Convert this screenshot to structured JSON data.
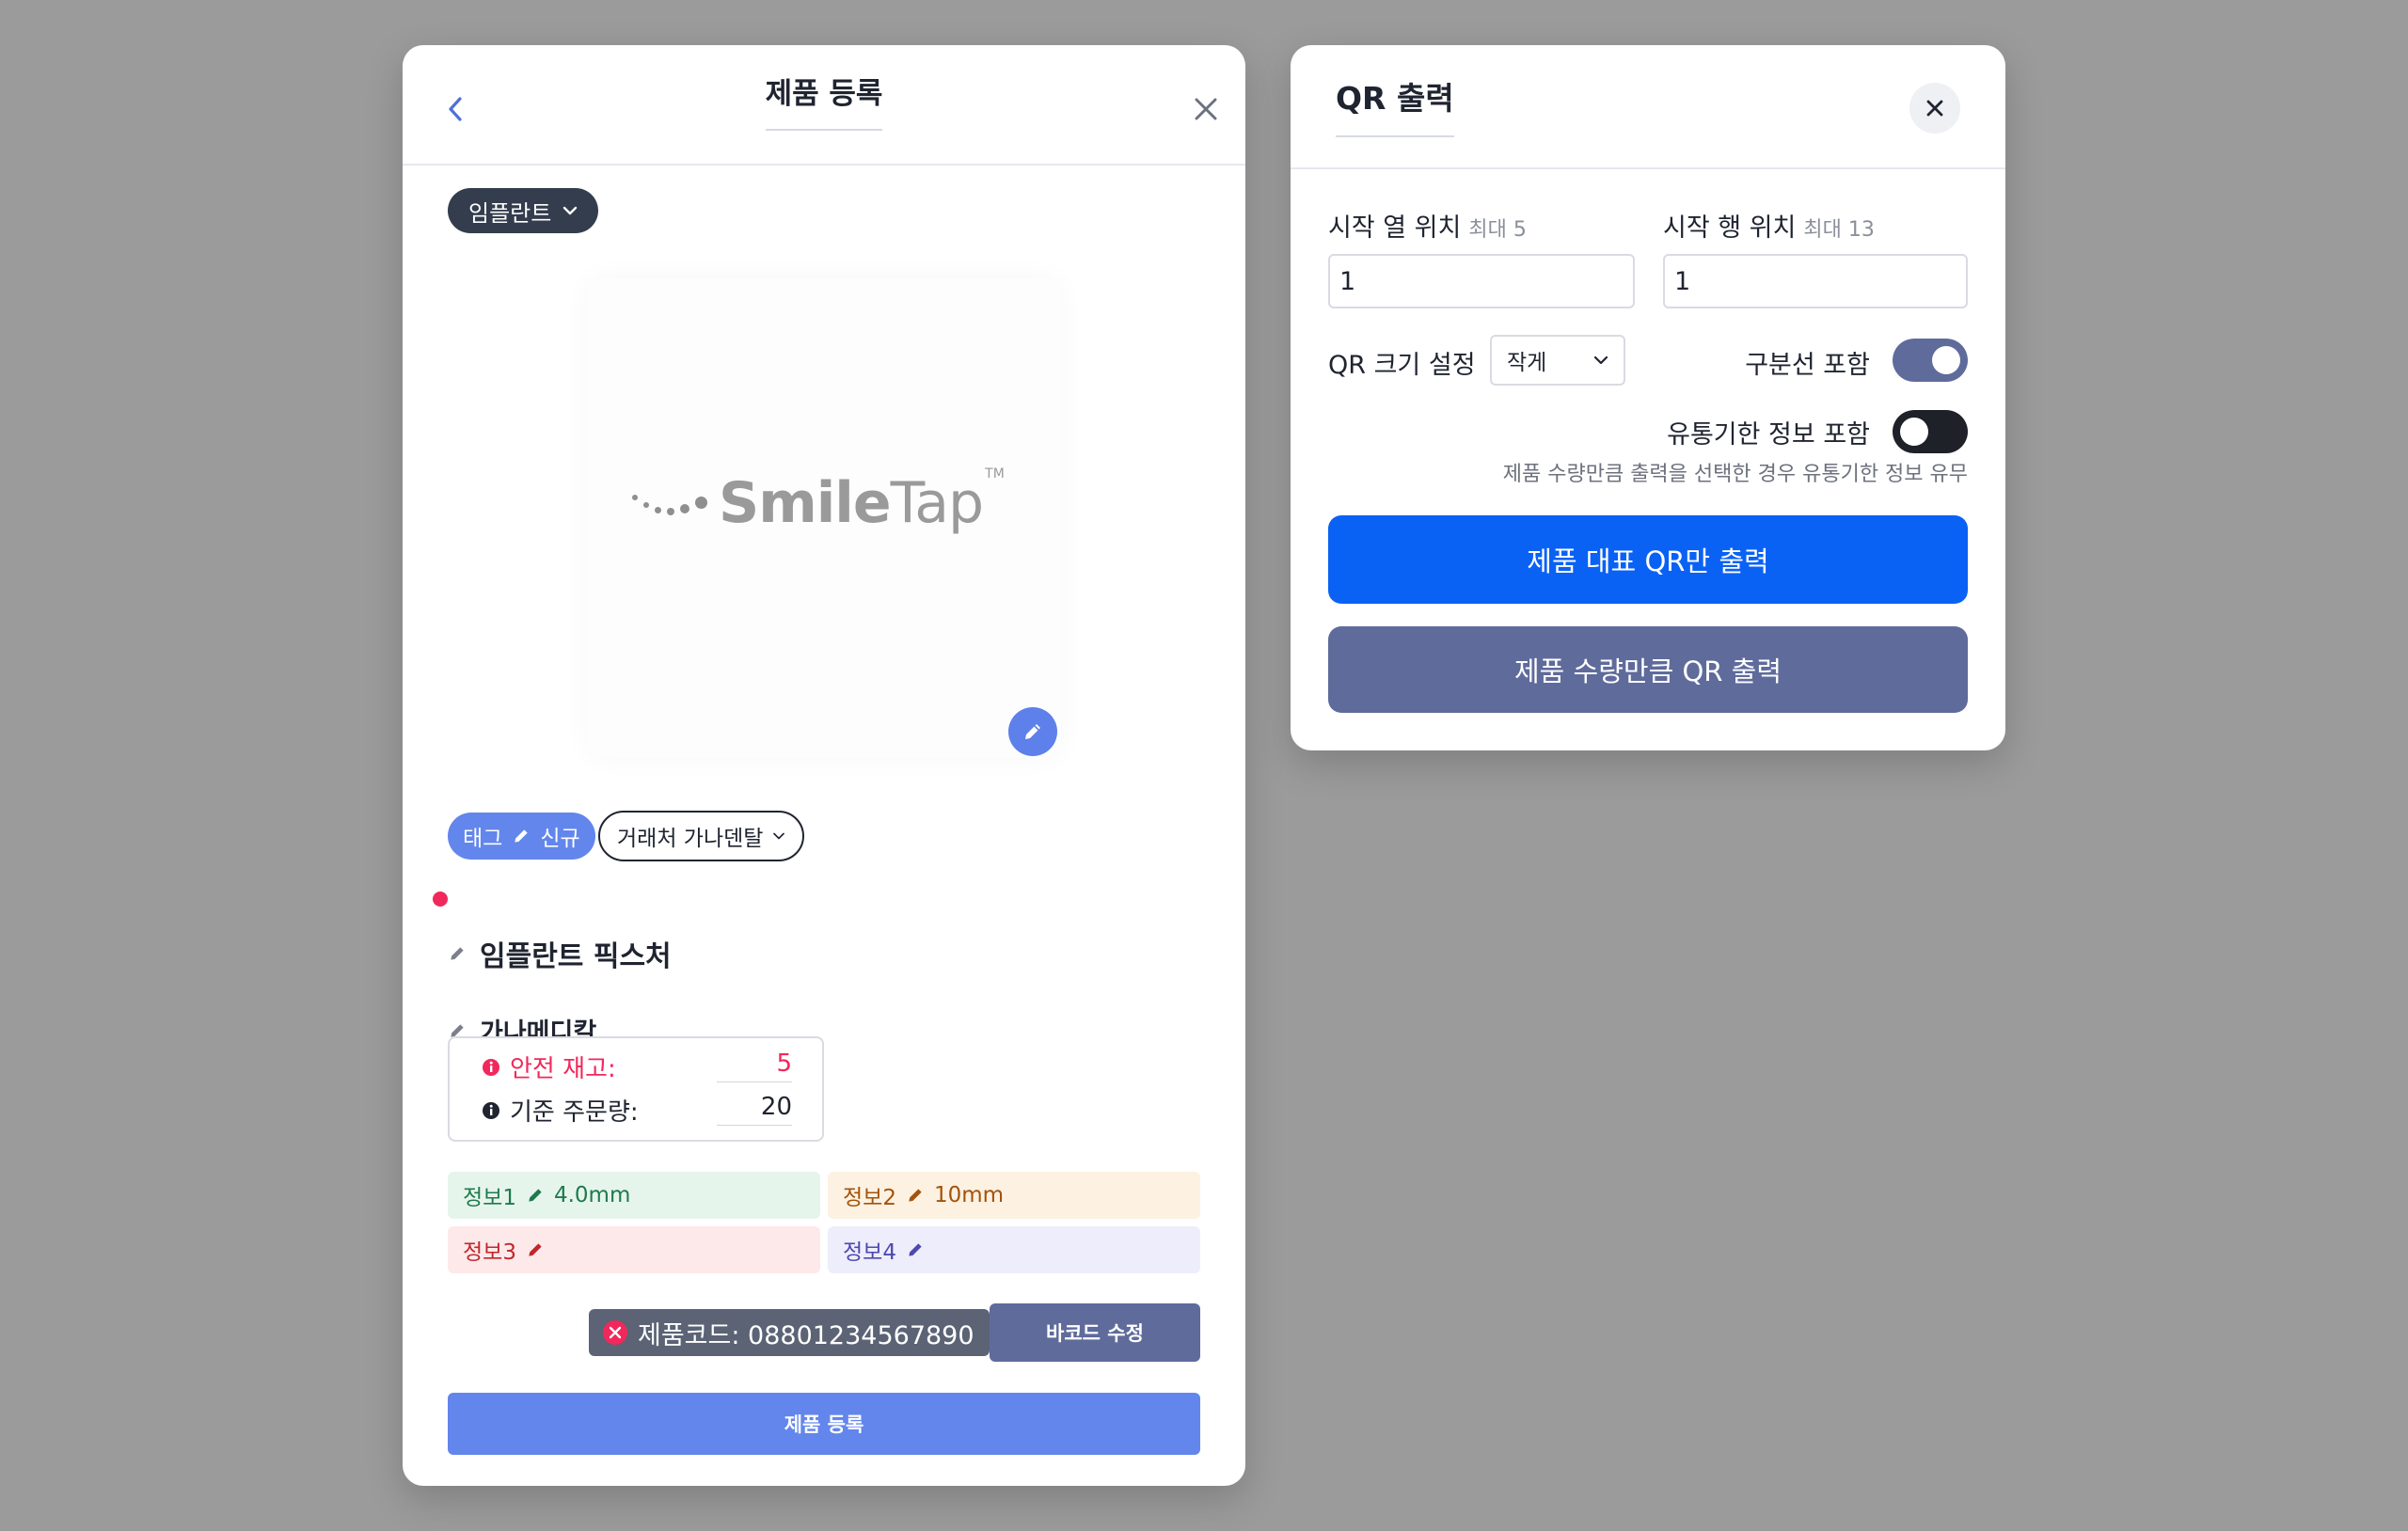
{
  "product_modal": {
    "title": "제품 등록",
    "category": "임플란트",
    "logo": {
      "main": "Smile",
      "sub": "Tap",
      "tm": "TM"
    },
    "tag": {
      "label": "태그",
      "value": "신규"
    },
    "supplier": "거래처 가나덴탈",
    "product_name": "임플란트 픽스처",
    "manufacturer": "가나메디칼",
    "safety_stock": {
      "label": "안전 재고:",
      "value": "5"
    },
    "order_qty": {
      "label": "기준 주문량:",
      "value": "20"
    },
    "info": [
      {
        "label": "정보1",
        "value": "4.0mm",
        "color": "#1f7a4d",
        "bg": "#e6f5ec"
      },
      {
        "label": "정보2",
        "value": "10mm",
        "color": "#a3530a",
        "bg": "#fdf1e2"
      },
      {
        "label": "정보3",
        "value": "",
        "color": "#c0272d",
        "bg": "#fde9e9"
      },
      {
        "label": "정보4",
        "value": "",
        "color": "#4c49b0",
        "bg": "#eeedfb"
      }
    ],
    "product_code": "제품코드: 08801234567890",
    "barcode_button": "바코드 수정",
    "submit_button": "제품 등록"
  },
  "qr_modal": {
    "title": "QR 출력",
    "start_col": {
      "label": "시작 열 위치",
      "hint": "최대 5",
      "value": "1"
    },
    "start_row": {
      "label": "시작 행 위치",
      "hint": "최대 13",
      "value": "1"
    },
    "size": {
      "label": "QR 크기 설정",
      "value": "작게"
    },
    "divider": {
      "label": "구분선 포함",
      "on": true
    },
    "expiry": {
      "label": "유통기한 정보 포함",
      "on": false
    },
    "hint": "제품 수량만큼 출력을 선택한 경우 유통기한 정보 유무",
    "primary_button": "제품 대표 QR만 출력",
    "secondary_button": "제품 수량만큼 QR 출력"
  },
  "colors": {
    "accent": "#6386ec",
    "primary_blue": "#0a62f5",
    "slate": "#5f6b9b",
    "alert": "#f1285b"
  }
}
